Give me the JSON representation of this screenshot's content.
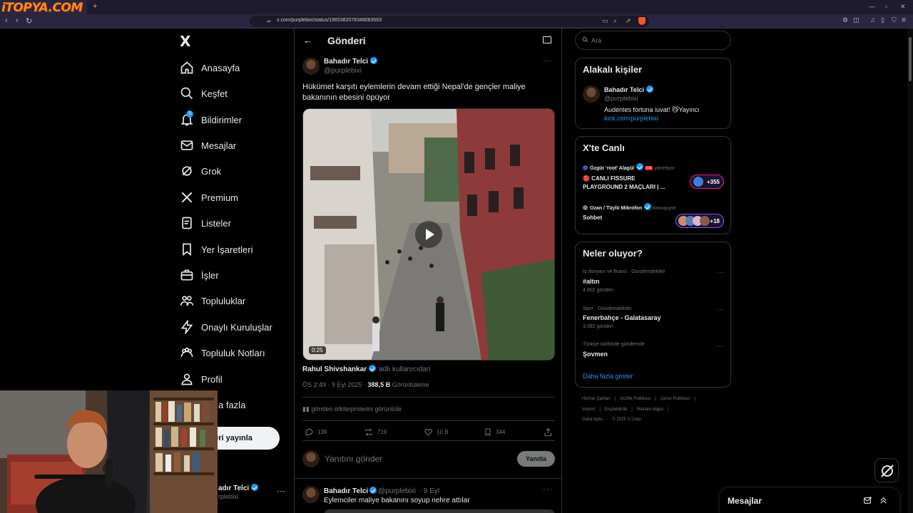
{
  "browser": {
    "tab_logo": "iTOPYA.COM",
    "new_tab": "+",
    "url": "x.com/purplebixi/status/1965382078348083563"
  },
  "sidebar": {
    "logo": "X",
    "items": [
      {
        "label": "Anasayfa",
        "icon": "home-icon"
      },
      {
        "label": "Keşfet",
        "icon": "search-icon"
      },
      {
        "label": "Bildirimler",
        "icon": "bell-icon",
        "badge": "3"
      },
      {
        "label": "Mesajlar",
        "icon": "mail-icon"
      },
      {
        "label": "Grok",
        "icon": "grok-icon"
      },
      {
        "label": "Premium",
        "icon": "x-premium-icon"
      },
      {
        "label": "Listeler",
        "icon": "list-icon"
      },
      {
        "label": "Yer İşaretleri",
        "icon": "bookmark-icon"
      },
      {
        "label": "İşler",
        "icon": "briefcase-icon"
      },
      {
        "label": "Topluluklar",
        "icon": "communities-icon"
      },
      {
        "label": "Onaylı Kuruluşlar",
        "icon": "lightning-icon"
      },
      {
        "label": "Topluluk Notları",
        "icon": "community-notes-icon"
      },
      {
        "label": "Profil",
        "icon": "person-icon"
      },
      {
        "label": "a fazla",
        "icon": "more-icon"
      }
    ],
    "post_button": "eri yayınla",
    "account_name": "adır Telci",
    "account_handle": "rplebixi",
    "account_more": "···"
  },
  "header": {
    "title": "Gönderi"
  },
  "tweet": {
    "author_name": "Bahadır Telci",
    "author_handle": "@purplebixi",
    "more": "···",
    "text": "Hükümet karşıtı eylemlerin devam ettiği Nepal'de gençler maliye bakanının ebesini öpüyor",
    "video_duration": "0:25",
    "credit_name": "Rahul Shivshankar",
    "credit_sub": "adlı kullanıcıdan",
    "time": "ÖS 2:49 · 9 Eyl 2025 · ",
    "views_count": "388,5 B",
    "views_label": " Görüntüleme",
    "engagements": "gönderi etkileşimlerini görüntüle",
    "actions": {
      "replies": "139",
      "reposts": "719",
      "likes": "10 B",
      "bookmarks": "344"
    },
    "reply_placeholder": "Yanıtını gönder",
    "reply_button": "Yanıtla"
  },
  "next_tweet": {
    "author_name": "Bahadır Telci",
    "author_handle": "@purplebixi",
    "time": "· 9 Eyl",
    "more": "···",
    "text": "Eylemciler maliye bakanını soyup nehre attılar"
  },
  "right": {
    "search_placeholder": "Ara",
    "related": {
      "title": "Alakalı kişiler",
      "name": "Bahadır Telci",
      "handle": "@purplebixi",
      "bio": "Audentes fortuna iuvat! 😼Yayıncı",
      "link": "kick.com/purplebixi"
    },
    "live": {
      "title": "X'te Canlı",
      "items": [
        {
          "host": "Özgür 'root' Alagül",
          "badge": "GS",
          "role": "yönetiyor",
          "title_line1": "🔴 CANLI FISSURE",
          "title_line2": "PLAYGROUND 2 MAÇLARI | ...",
          "count": "+355"
        },
        {
          "host": "Ozan / Tüylü Mikrofon",
          "role": "konuşuyor",
          "title_line1": "Sohbet",
          "count": "+18"
        }
      ]
    },
    "trends": {
      "title": "Neler oluyor?",
      "items": [
        {
          "category": "İş dünyası ve finans · Gündemdekiler",
          "name": "#altın",
          "count": "4.802 gönderi"
        },
        {
          "category": "Spor · Gündemdekiler",
          "name": "Fenerbahçe - Galatasaray",
          "count": "3.082 gönderi"
        },
        {
          "category": "Türkiye tarihinde gündemde",
          "name": "Şovmen",
          "count": ""
        }
      ],
      "show_more": "Daha fazla göster"
    },
    "footer": {
      "row1": [
        "Hizmet Şartları",
        "|",
        "Gizlilik Politikası",
        "|",
        "Çerez Politikası",
        "|"
      ],
      "row2": [
        "Imprint",
        "|",
        "Erişilebilirlik",
        "|",
        "Reklam bilgisi",
        "|"
      ],
      "row3": [
        "Daha fazla ···",
        "© 2025 X Corp."
      ]
    }
  },
  "messages_drawer": {
    "title": "Mesajlar"
  },
  "colors": {
    "accent": "#1d9bf0",
    "background": "#000000",
    "text": "#e7e9ea",
    "muted": "#71767b",
    "border": "#2f3336"
  }
}
